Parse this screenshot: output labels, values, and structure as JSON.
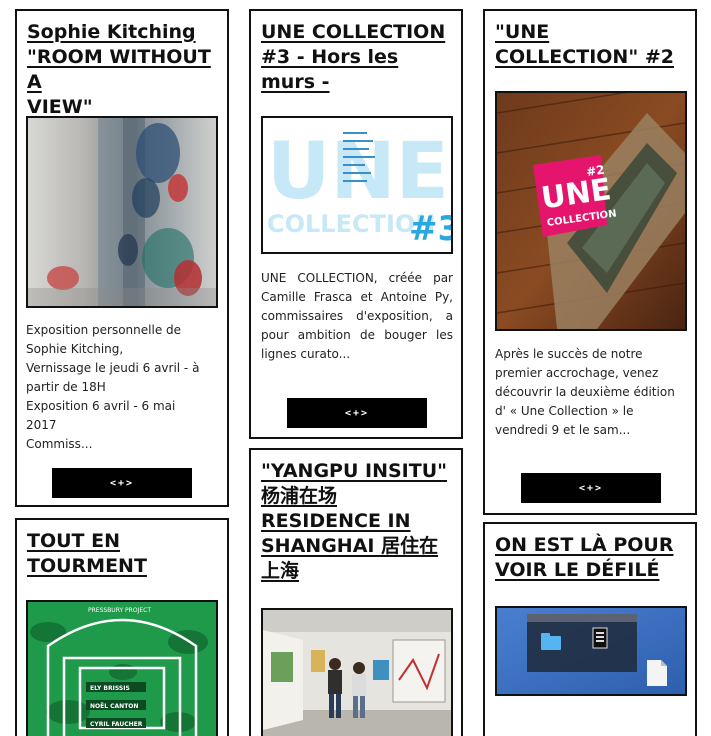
{
  "cards": [
    {
      "title_lines": [
        "Sophie Kitching",
        "\"ROOM WITHOUT A",
        "VIEW\""
      ],
      "excerpt_lines": [
        "Exposition personnelle de",
        "Sophie Kitching,",
        "Vernissage le jeudi 6 avril - à",
        "partir de 18H",
        "Exposition 6 avril - 6 mai",
        "2017",
        "Commiss..."
      ],
      "button_label": "<+>"
    },
    {
      "title_lines": [
        "UNE COLLECTION",
        "#3 - Hors les",
        "murs -"
      ],
      "thumb_text": {
        "une": "UNE",
        "collection": "COLLECTION",
        "number": "#3"
      },
      "excerpt_lines": [
        "UNE COLLECTION, créée par",
        "Camille Frasca et Antoine Py,",
        "commissaires d'exposition, a",
        "pour ambition de bouger les",
        "lignes curato..."
      ],
      "button_label": "<+>"
    },
    {
      "title_lines": [
        "\"UNE",
        "COLLECTION\" #2"
      ],
      "thumb_text": {
        "une": "UNE",
        "collection": "COLLECTION",
        "number": "#2"
      },
      "excerpt_lines": [
        "Après le succès de notre",
        "premier accrochage, venez",
        "découvrir la deuxième édition",
        "d' « Une Collection » le",
        "vendredi 9 et le sam..."
      ],
      "button_label": "<+>"
    },
    {
      "title_lines": [
        "TOUT EN",
        "TOURMENT"
      ],
      "thumb_text": {
        "top": "PRESSBURY PROJECT",
        "n1": "ELY BRISSIS",
        "n2": "NOËL CANTON",
        "n3": "CYRIL FAUCHER"
      }
    },
    {
      "title_lines": [
        "\"YANGPU INSITU\"",
        "杨浦在场",
        "RESIDENCE IN",
        "SHANGHAI 居住在",
        "上海"
      ]
    },
    {
      "title_lines": [
        "ON EST LÀ POUR",
        "VOIR LE DÉFILÉ"
      ]
    }
  ],
  "colors": {
    "page_bg": "#ffffff",
    "border": "#111111",
    "button_bg": "#000000",
    "une3_light_blue": "#bfe6f5",
    "une3_blue": "#2aa7de",
    "une2_pink": "#e5156e",
    "tout_green": "#1f9a4a",
    "defile_blue": "#3d73c4"
  },
  "icons": [
    "folder-icon",
    "document-icon"
  ]
}
